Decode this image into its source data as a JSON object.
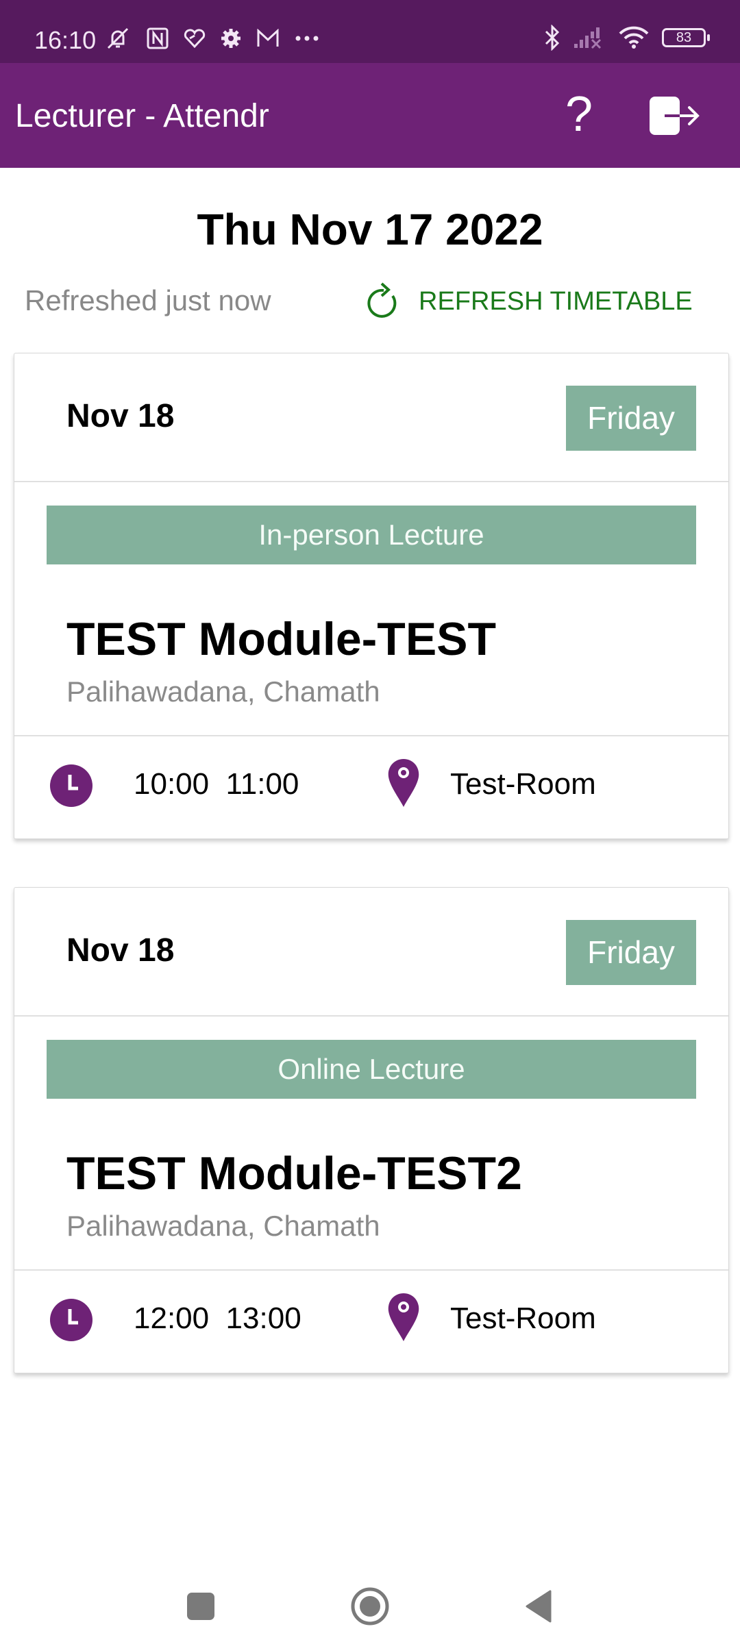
{
  "status_bar": {
    "time": "16:10",
    "left_icons": [
      "mute-bell-icon",
      "nfc-icon",
      "health-icon",
      "settings-icon",
      "gmail-icon",
      "more-dots-icon"
    ],
    "right_icons": [
      "bluetooth-icon",
      "signal-no-service-icon",
      "wifi-icon",
      "battery-icon"
    ],
    "battery_level": "83"
  },
  "app_bar": {
    "title": "Lecturer - Attendr",
    "help_icon": "?",
    "logout_icon": "logout-icon"
  },
  "header": {
    "date": "Thu Nov 17 2022",
    "refreshed_text": "Refreshed just now",
    "refresh_button_label": "REFRESH TIMETABLE"
  },
  "colors": {
    "status_bar": "#561a5e",
    "primary": "#6e2276",
    "badge": "#83b19c",
    "refresh": "#1a7a1a"
  },
  "lectures": [
    {
      "date": "Nov 18",
      "day": "Friday",
      "type": "In-person Lecture",
      "module": "TEST Module-TEST",
      "lecturer": "Palihawadana, Chamath",
      "start": "10:00",
      "end": "11:00",
      "time_display": "10:00  11:00",
      "room": "Test-Room"
    },
    {
      "date": "Nov 18",
      "day": "Friday",
      "type": "Online Lecture",
      "module": "TEST Module-TEST2",
      "lecturer": "Palihawadana, Chamath",
      "start": "12:00",
      "end": "13:00",
      "time_display": "12:00  13:00",
      "room": "Test-Room"
    }
  ],
  "nav_bar": {
    "buttons": [
      "recents",
      "home",
      "back"
    ]
  }
}
